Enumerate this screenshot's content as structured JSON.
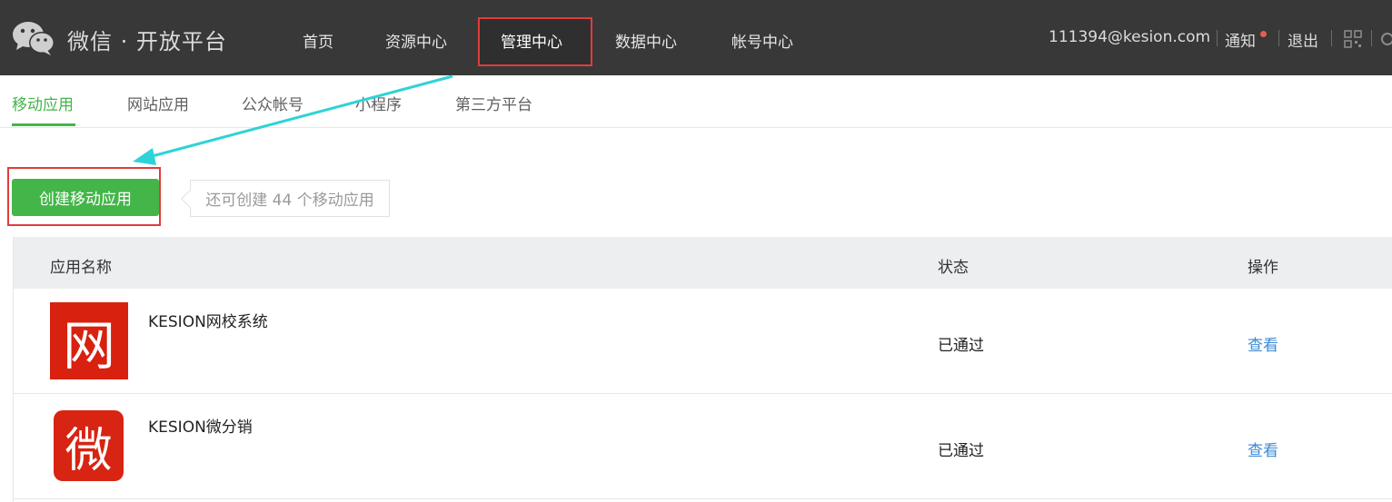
{
  "header": {
    "brand": "微信 · 开放平台",
    "nav": [
      "首页",
      "资源中心",
      "管理中心",
      "数据中心",
      "帐号中心"
    ],
    "account_email": "111394@kesion.com",
    "notice_label": "通知",
    "logout_label": "退出"
  },
  "subtabs": [
    "移动应用",
    "网站应用",
    "公众帐号",
    "小程序",
    "第三方平台"
  ],
  "actions": {
    "create_label": "创建移动应用",
    "quota_text": "还可创建 44 个移动应用"
  },
  "table": {
    "headers": [
      "应用名称",
      "状态",
      "操作"
    ],
    "rows": [
      {
        "icon_char": "网",
        "name": "KESION网校系统",
        "status": "已通过",
        "action": "查看"
      },
      {
        "icon_char": "微",
        "name": "KESION微分销",
        "status": "已通过",
        "action": "查看"
      }
    ]
  },
  "colors": {
    "accent_green": "#44b549",
    "highlight_red": "#e33b3b",
    "arrow_cyan": "#2fd3d6",
    "link_blue": "#3d8ad6"
  }
}
